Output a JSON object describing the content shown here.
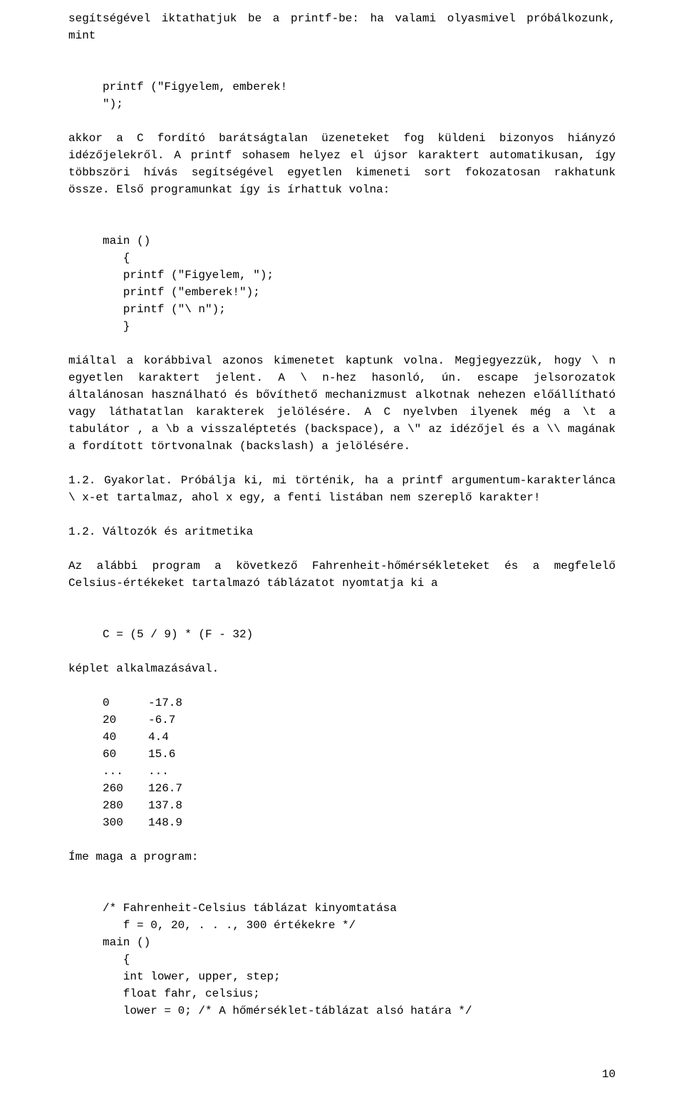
{
  "p1": "segítségével iktathatjuk be a printf-be: ha valami olyasmivel próbálkozunk, mint",
  "code1_l1": "printf (\"Figyelem, emberek!",
  "code1_l2": "\");",
  "p2": "akkor a C fordító barátságtalan üzeneteket fog küldeni bizonyos hiányzó idézőjelekről. A printf sohasem helyez el újsor karaktert automatikusan, így többszöri hívás segítségével egyetlen kimeneti sort fokozatosan rakhatunk össze. Első programunkat így is írhattuk volna:",
  "code2_l1": "main ()",
  "code2_l2": "   {",
  "code2_l3": "   printf (\"Figyelem, \");",
  "code2_l4": "   printf (\"emberek!\");",
  "code2_l5": "   printf (\"\\ n\");",
  "code2_l6": "   }",
  "p3": "miáltal a korábbival azonos kimenetet kaptunk volna.\nMegjegyezzük, hogy \\ n egyetlen karaktert jelent. A \\ n-hez hasonló, ún. escape jelsorozatok általánosan használható és bővíthető mechanizmust alkotnak nehezen előállítható vagy láthatatlan karakterek jelölésére. A C nyelvben ilyenek még a \\t a tabulátor , a \\b a visszaléptetés (backspace), a \\\" az idézőjel és a \\\\ magának a fordított törtvonalnak (backslash) a jelölésére.",
  "p4": "1.2. Gyakorlat. Próbálja ki, mi történik, ha a printf argumentum-karakterlánca \\ x-et tartalmaz, ahol x egy, a fenti listában nem szereplő karakter!",
  "heading1": "1.2. Változók és aritmetika",
  "p5": "Az alábbi program a következő Fahrenheit-hőmérsékleteket és a megfelelő Celsius-értékeket tartalmazó táblázatot nyomtatja ki a",
  "formula": "C = (5 / 9) * (F - 32)",
  "p6": "képlet alkalmazásával.",
  "table_rows": [
    {
      "a": "0",
      "b": "-17.8"
    },
    {
      "a": "20",
      "b": "-6.7"
    },
    {
      "a": "40",
      "b": "4.4"
    },
    {
      "a": "60",
      "b": "15.6"
    },
    {
      "a": "...",
      "b": "..."
    },
    {
      "a": "260",
      "b": "126.7"
    },
    {
      "a": "280",
      "b": "137.8"
    },
    {
      "a": "300",
      "b": "148.9"
    }
  ],
  "p7": "Íme maga a program:",
  "code3_l1": "/* Fahrenheit-Celsius táblázat kinyomtatása",
  "code3_l2": "   f = 0, 20, . . ., 300 értékekre */",
  "code3_l3": "main ()",
  "code3_l4": "   {",
  "code3_l5": "   int lower, upper, step;",
  "code3_l6": "   float fahr, celsius;",
  "code3_l7": "   lower = 0; /* A hőmérséklet-táblázat alsó határa */",
  "page_number": "10"
}
